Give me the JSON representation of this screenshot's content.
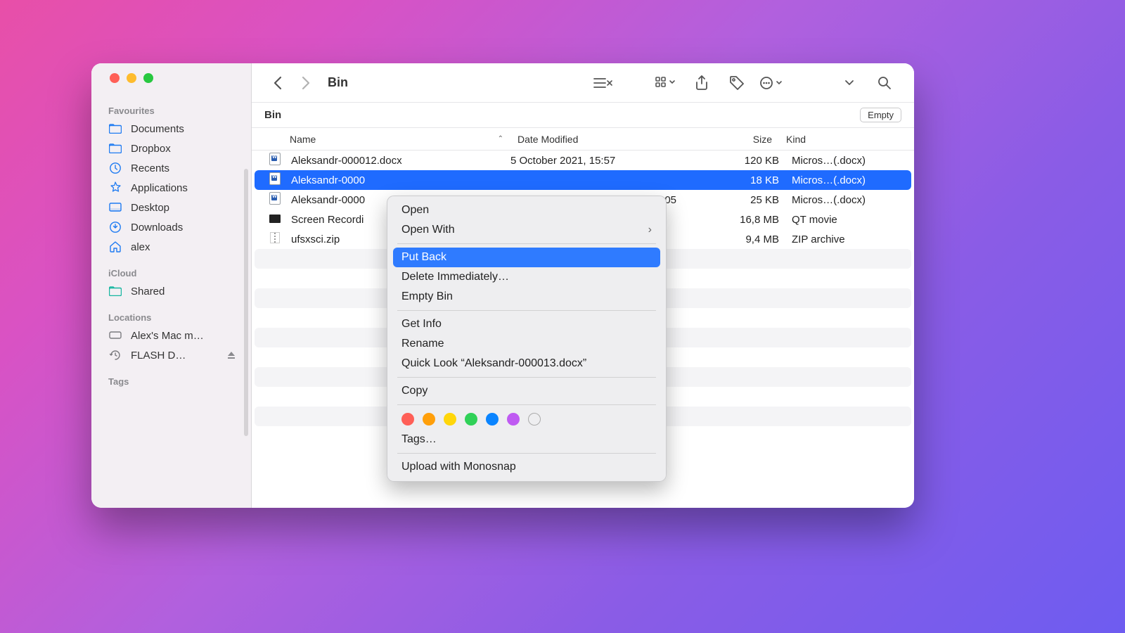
{
  "window": {
    "title": "Bin",
    "path_label": "Bin",
    "empty_button": "Empty"
  },
  "columns": {
    "name": "Name",
    "date": "Date Modified",
    "size": "Size",
    "kind": "Kind"
  },
  "sidebar": {
    "favourites_label": "Favourites",
    "favourites": [
      {
        "label": "Documents"
      },
      {
        "label": "Dropbox"
      },
      {
        "label": "Recents"
      },
      {
        "label": "Applications"
      },
      {
        "label": "Desktop"
      },
      {
        "label": "Downloads"
      },
      {
        "label": "alex"
      }
    ],
    "icloud_label": "iCloud",
    "icloud": [
      {
        "label": "Shared"
      }
    ],
    "locations_label": "Locations",
    "locations": [
      {
        "label": "Alex's Mac m…"
      },
      {
        "label": "FLASH D…"
      }
    ],
    "tags_label": "Tags"
  },
  "files": [
    {
      "name": "Aleksandr-000012.docx",
      "date": "5 October 2021, 15:57",
      "size": "120 KB",
      "kind": "Micros…(.docx)",
      "type": "doc"
    },
    {
      "name": "Aleksandr-0000",
      "date": "",
      "size": "18 KB",
      "kind": "Micros…(.docx)",
      "type": "doc"
    },
    {
      "name": "Aleksandr-0000",
      "date": "05",
      "size": "25 KB",
      "kind": "Micros…(.docx)",
      "type": "doc"
    },
    {
      "name": "Screen Recordi",
      "date": "",
      "size": "16,8 MB",
      "kind": "QT movie",
      "type": "mov"
    },
    {
      "name": "ufsxsci.zip",
      "date": "",
      "size": "9,4 MB",
      "kind": "ZIP archive",
      "type": "zip"
    }
  ],
  "context_menu": {
    "open": "Open",
    "open_with": "Open With",
    "put_back": "Put Back",
    "delete_immediately": "Delete Immediately…",
    "empty_bin": "Empty Bin",
    "get_info": "Get Info",
    "rename": "Rename",
    "quick_look": "Quick Look “Aleksandr-000013.docx”",
    "copy": "Copy",
    "tags": "Tags…",
    "upload": "Upload with Monosnap",
    "tag_colors": [
      "#ff5f57",
      "#ff9f0a",
      "#ffd60a",
      "#30d158",
      "#0a84ff",
      "#bf5af2",
      "transparent"
    ]
  }
}
